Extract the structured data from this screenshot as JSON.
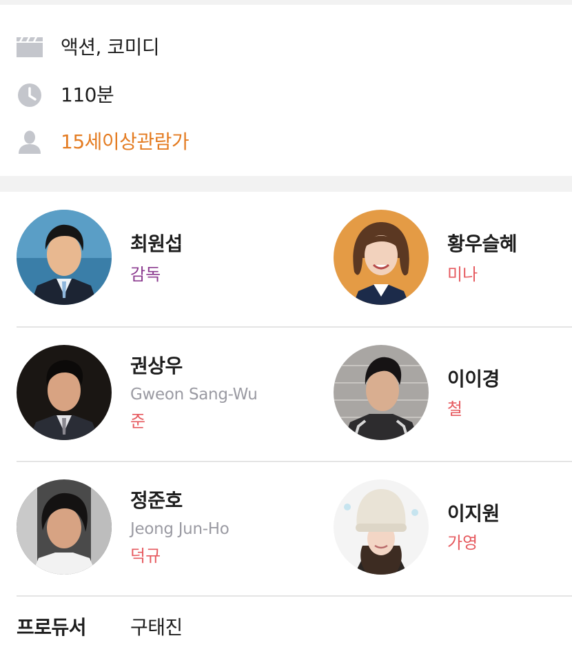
{
  "info": {
    "genre": "액션, 코미디",
    "runtime": "110분",
    "rating": "15세이상관람가",
    "genre_icon": "clapperboard-icon",
    "runtime_icon": "clock-icon",
    "rating_icon": "person-icon"
  },
  "cast": [
    {
      "name": "최원섭",
      "role": "감독"
    },
    {
      "name": "황우슬혜",
      "role": "미나"
    },
    {
      "name": "권상우",
      "name_en": "Gweon Sang-Wu",
      "role": "준"
    },
    {
      "name": "이이경",
      "role": "철"
    },
    {
      "name": "정준호",
      "name_en": "Jeong Jun-Ho",
      "role": "덕규"
    },
    {
      "name": "이지원",
      "role": "가영"
    }
  ],
  "producer": {
    "label": "프로듀서",
    "name": "구태진"
  },
  "colors": {
    "rating": "#e47c22",
    "director_role": "#8b3a8f",
    "role": "#e65a5f",
    "icon_gray": "#c4c6cc"
  }
}
